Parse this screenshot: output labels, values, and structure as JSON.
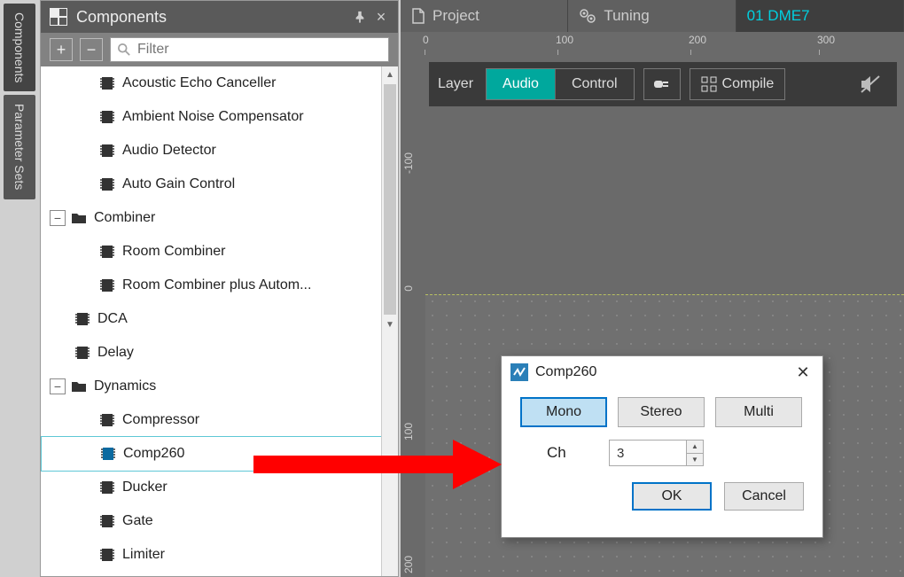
{
  "sideTabs": {
    "components": "Components",
    "paramSets": "Parameter Sets"
  },
  "panel": {
    "title": "Components",
    "expandAll": "+",
    "collapseAll": "−",
    "filterPlaceholder": "Filter",
    "items": [
      {
        "type": "leaf",
        "level": 1,
        "text": "Acoustic Echo Canceller"
      },
      {
        "type": "leaf",
        "level": 1,
        "text": "Ambient Noise Compensator"
      },
      {
        "type": "leaf",
        "level": 1,
        "text": "Audio Detector"
      },
      {
        "type": "leaf",
        "level": 1,
        "text": "Auto Gain Control"
      },
      {
        "type": "group",
        "level": 0,
        "text": "Combiner",
        "exp": "−"
      },
      {
        "type": "leaf",
        "level": 1,
        "text": "Room Combiner"
      },
      {
        "type": "leaf",
        "level": 1,
        "text": "Room Combiner plus Autom..."
      },
      {
        "type": "leaf",
        "level": 0,
        "text": "DCA"
      },
      {
        "type": "leaf",
        "level": 0,
        "text": "Delay"
      },
      {
        "type": "group",
        "level": 0,
        "text": "Dynamics",
        "exp": "−"
      },
      {
        "type": "leaf",
        "level": 1,
        "text": "Compressor"
      },
      {
        "type": "leaf",
        "level": 1,
        "text": "Comp260",
        "selected": true
      },
      {
        "type": "leaf",
        "level": 1,
        "text": "Ducker"
      },
      {
        "type": "leaf",
        "level": 1,
        "text": "Gate"
      },
      {
        "type": "leaf",
        "level": 1,
        "text": "Limiter"
      }
    ]
  },
  "topTabs": {
    "project": "Project",
    "tuning": "Tuning",
    "device": "01 DME7"
  },
  "hruler": [
    "0",
    "100",
    "200",
    "300"
  ],
  "vruler": [
    "-100",
    "0",
    "100",
    "200"
  ],
  "toolbar": {
    "layer": "Layer",
    "audio": "Audio",
    "control": "Control",
    "compile": "Compile"
  },
  "dialog": {
    "title": "Comp260",
    "mono": "Mono",
    "stereo": "Stereo",
    "multi": "Multi",
    "chLabel": "Ch",
    "chValue": "3",
    "ok": "OK",
    "cancel": "Cancel"
  }
}
